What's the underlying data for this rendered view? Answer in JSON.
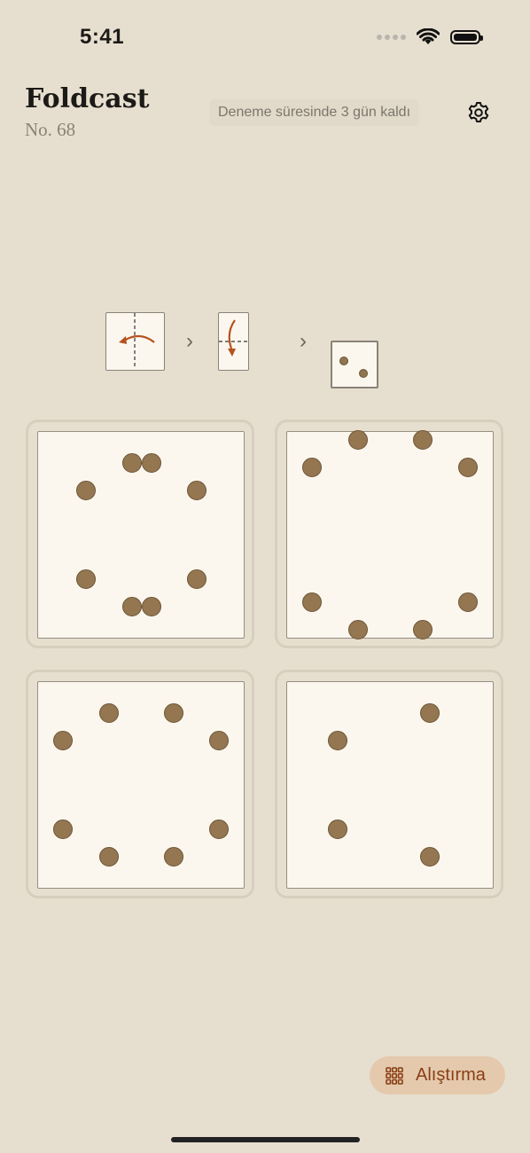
{
  "status": {
    "time": "5:41"
  },
  "header": {
    "title": "Foldcast",
    "subtitle": "No. 68",
    "trial_text": "Deneme süresinde 3 gün kaldı"
  },
  "puzzle": {
    "steps": [
      "fold-left-step",
      "fold-down-step"
    ],
    "result_dots": 2
  },
  "options": [
    {
      "label": "option-1",
      "dot_count": 8
    },
    {
      "label": "option-2",
      "dot_count": 8
    },
    {
      "label": "option-3",
      "dot_count": 8
    },
    {
      "label": "option-4",
      "dot_count": 4
    }
  ],
  "footer": {
    "practice_label": "Alıştırma"
  },
  "colors": {
    "background": "#e6dfcf",
    "paper": "#fbf7ee",
    "dot": "#947651",
    "accent": "#8a3e14",
    "arrow": "#b5521f"
  }
}
